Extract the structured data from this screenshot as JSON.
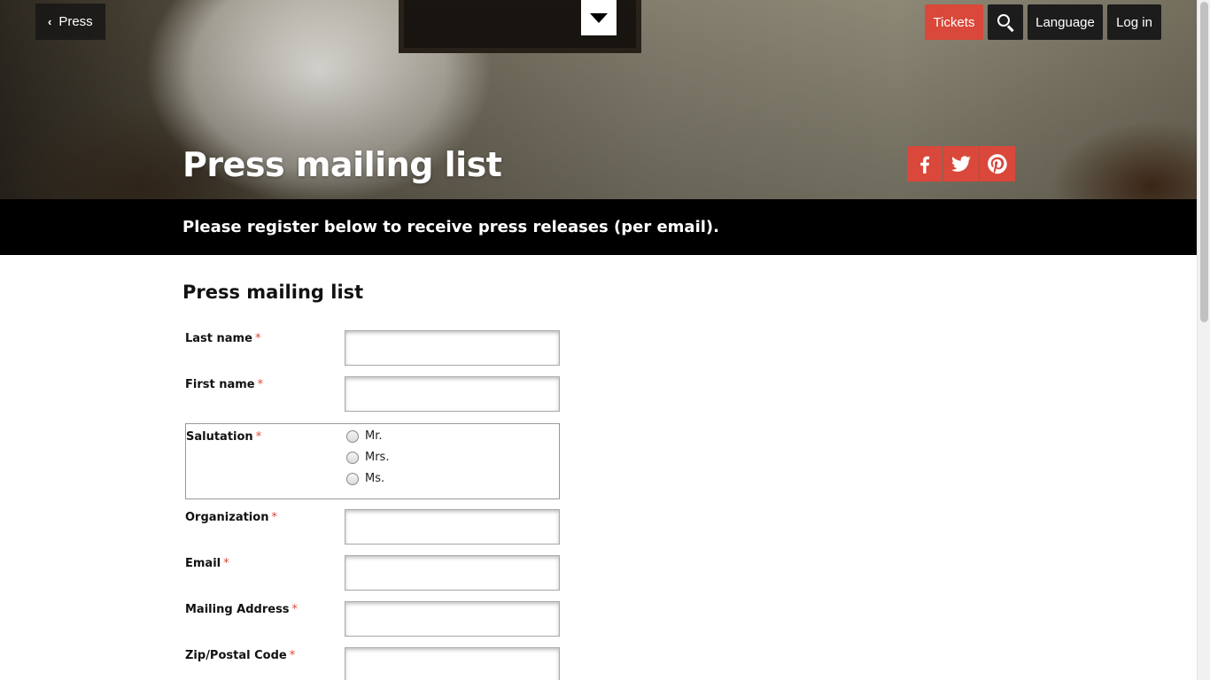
{
  "header": {
    "back_label": "Press",
    "tickets_label": "Tickets",
    "language_label": "Language",
    "login_label": "Log in"
  },
  "hero": {
    "title": "Press mailing list",
    "intro": "Please register below to receive press releases (per email)."
  },
  "social": [
    "facebook-icon",
    "twitter-icon",
    "pinterest-icon"
  ],
  "form": {
    "title": "Press mailing list",
    "required_marker": "*",
    "fields": {
      "last_name": "Last name",
      "first_name": "First name",
      "salutation": "Salutation",
      "organization": "Organization",
      "email": "Email",
      "mailing_address": "Mailing Address",
      "zip": "Zip/Postal Code"
    },
    "salutation_options": [
      "Mr.",
      "Mrs.",
      "Ms."
    ]
  },
  "colors": {
    "accent": "#d9483a",
    "dark_button": "#1c1c1c",
    "band": "#000000"
  }
}
